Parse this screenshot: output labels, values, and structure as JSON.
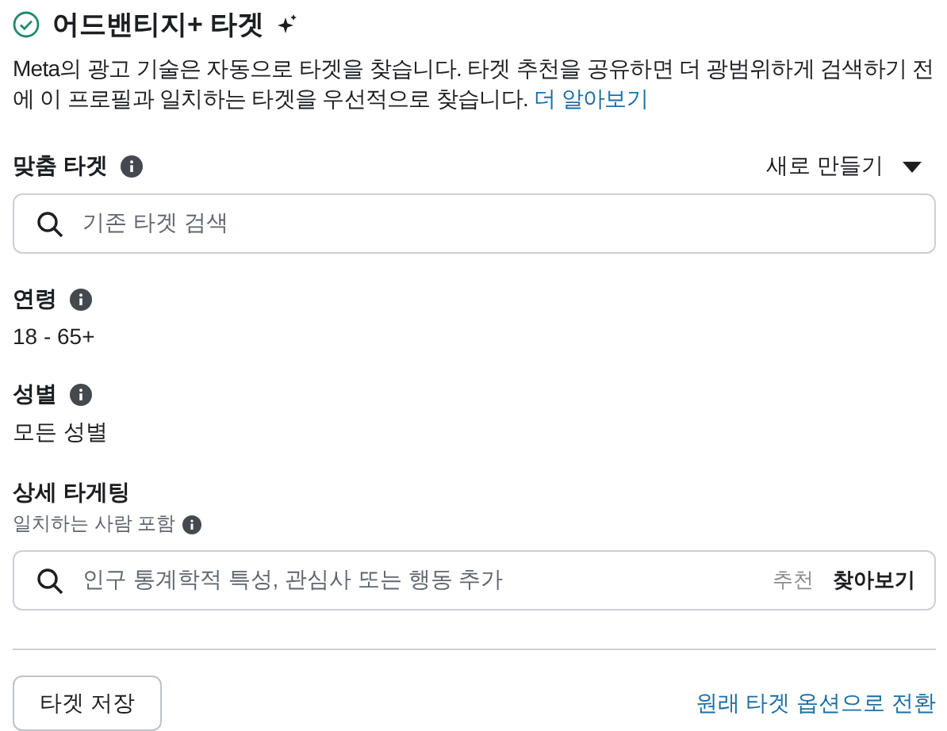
{
  "header": {
    "title": "어드밴티지+ 타겟",
    "checked": true
  },
  "description": {
    "text": "Meta의 광고 기술은 자동으로 타겟을 찾습니다. 타겟 추천을 공유하면 더 광범위하게 검색하기 전에 이 프로필과 일치하는 타겟을 우선적으로 찾습니다.",
    "link": "더 알아보기"
  },
  "sections": [
    {
      "kind": "search",
      "label": "맞춤 타겟",
      "action": "새로 만들기",
      "placeholder": "기존 타겟 검색"
    },
    {
      "kind": "value",
      "label": "연령",
      "value": "18 - 65+"
    },
    {
      "kind": "value",
      "label": "성별",
      "value": "모든 성별"
    },
    {
      "kind": "detailed",
      "label": "상세 타게팅",
      "sublabel": "일치하는 사람 포함",
      "placeholder": "인구 통계학적 특성, 관심사 또는 행동 추가",
      "suggest": "추천",
      "browse": "찾아보기"
    }
  ],
  "footer": {
    "save": "타겟 저장",
    "switch": "원래 타겟 옵션으로 전환"
  }
}
